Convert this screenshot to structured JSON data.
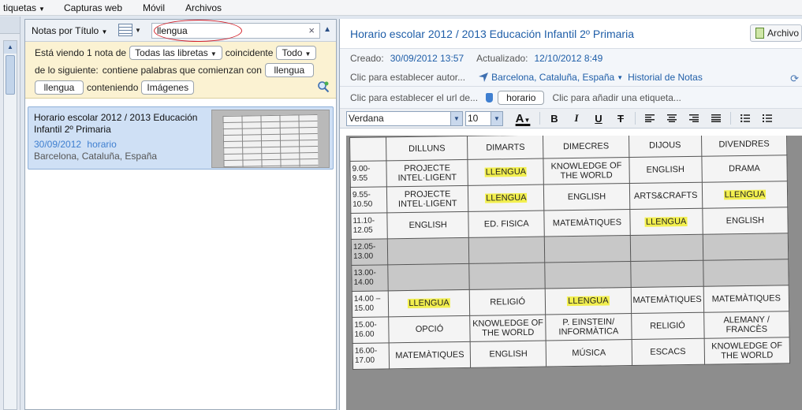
{
  "menu": [
    {
      "label": "tiquetas",
      "caret": "▼"
    },
    {
      "label": "Capturas web"
    },
    {
      "label": "Móvil"
    },
    {
      "label": "Archivos"
    }
  ],
  "list": {
    "sort_label": "Notas por Título",
    "search_value": "llengua",
    "search_clear": "×",
    "filter": {
      "viewing_prefix": "Está viendo 1 nota de",
      "notebooks": "Todas las libretas",
      "matching": "coincidente",
      "match_mode": "Todo",
      "following_prefix": "de lo siguiente:",
      "contains_words": "contiene palabras que comienzan con",
      "word1": "llengua",
      "word2": "llengua",
      "containing": "conteniendo",
      "content_type": "Imágenes"
    },
    "note": {
      "title": "Horario escolar  2012 / 2013 Educación Infantil 2º Primaria",
      "date": "30/09/2012",
      "tag": "horario",
      "location": "Barcelona, Cataluña, España"
    }
  },
  "detail": {
    "title": "Horario escolar  2012 / 2013 Educación Infantil 2º Primaria",
    "archive_label": "Archivo",
    "created_label": "Creado:",
    "created_value": "30/09/2012 13:57",
    "updated_label": "Actualizado:",
    "updated_value": "12/10/2012 8:49",
    "author_placeholder": "Clic para establecer autor...",
    "location": "Barcelona, Cataluña, España",
    "history": "Historial de Notas",
    "url_placeholder": "Clic para establecer el url de...",
    "tag": "horario",
    "add_tag": "Clic para añadir una etiqueta...",
    "font": "Verdana",
    "size": "10",
    "bold": "B",
    "italic": "I",
    "underline": "U",
    "strike": "T",
    "text_color": "A"
  },
  "timetable": {
    "days": [
      "DILLUNS",
      "DIMARTS",
      "DIMECRES",
      "DIJOUS",
      "DIVENDRES"
    ],
    "rows": [
      {
        "time": "9.00-9.55",
        "cells": [
          "PROJECTE INTEL·LIGENT",
          "LLENGUA",
          "KNOWLEDGE OF THE WORLD",
          "ENGLISH",
          "DRAMA"
        ]
      },
      {
        "time": "9.55-10.50",
        "cells": [
          "PROJECTE INTEL·LIGENT",
          "LLENGUA",
          "ENGLISH",
          "ARTS&CRAFTS",
          "LLENGUA"
        ]
      },
      {
        "time": "11.10-12.05",
        "cells": [
          "ENGLISH",
          "ED. FISICA",
          "MATEMÀTIQUES",
          "LLENGUA",
          "ENGLISH"
        ]
      },
      {
        "time": "12.05-13.00",
        "cells": [
          "",
          "",
          "",
          "",
          ""
        ]
      },
      {
        "time": "13.00-14.00",
        "cells": [
          "",
          "",
          "",
          "",
          ""
        ]
      },
      {
        "time": "14.00 – 15.00",
        "cells": [
          "LLENGUA",
          "RELIGIÓ",
          "LLENGUA",
          "MATEMÀTIQUES",
          "MATEMÀTIQUES"
        ]
      },
      {
        "time": "15.00-16.00",
        "cells": [
          "OPCIÓ",
          "KNOWLEDGE OF THE WORLD",
          "P. EINSTEIN/ INFORMÀTICA",
          "RELIGIÓ",
          "ALEMANY / FRANCÈS"
        ]
      },
      {
        "time": "16.00-17.00",
        "cells": [
          "MATEMÀTIQUES",
          "ENGLISH",
          "MÚSICA",
          "ESCACS",
          "KNOWLEDGE OF THE WORLD"
        ]
      }
    ],
    "highlight_word": "LLENGUA"
  }
}
